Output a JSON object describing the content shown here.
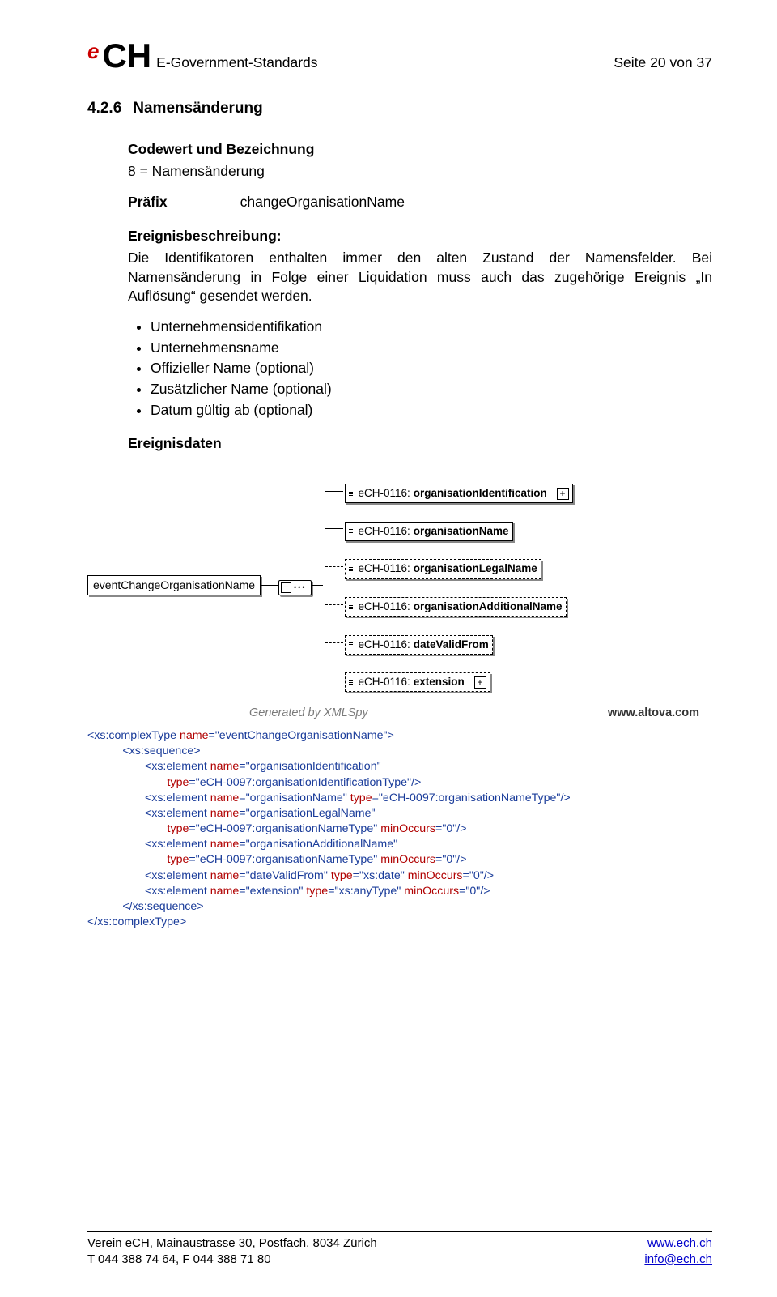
{
  "header": {
    "subtitle": "E-Government-Standards",
    "page_indicator": "Seite 20 von 37"
  },
  "logo": {
    "e": "e",
    "ch": "CH"
  },
  "section": {
    "number": "4.2.6",
    "title": "Namensänderung"
  },
  "codewert": {
    "heading": "Codewert und Bezeichnung",
    "value": "8 = Namensänderung"
  },
  "prefix": {
    "label": "Präfix",
    "value": "changeOrganisationName"
  },
  "ereignis_heading": "Ereignisbeschreibung:",
  "ereignis_text": "Die Identifikatoren enthalten immer den alten Zustand der Namensfelder. Bei Namensänderung in Folge einer Liquidation muss auch das zugehörige Ereignis „In Auflösung“ gesendet werden.",
  "bullets": [
    "Unternehmensidentifikation",
    "Unternehmensname",
    "Offizieller Name (optional)",
    "Zusätzlicher Name (optional)",
    "Datum gültig ab (optional)"
  ],
  "ereignisdaten_heading": "Ereignisdaten",
  "chart_data": {
    "type": "tree",
    "root": "eventChangeOrganisationName",
    "prefix": "eCH-0116:",
    "children": [
      {
        "name": "organisationIdentification",
        "optional": false,
        "expandable": true
      },
      {
        "name": "organisationName",
        "optional": false,
        "expandable": false
      },
      {
        "name": "organisationLegalName",
        "optional": true,
        "expandable": false
      },
      {
        "name": "organisationAdditionalName",
        "optional": true,
        "expandable": false
      },
      {
        "name": "dateValidFrom",
        "optional": true,
        "expandable": false
      },
      {
        "name": "extension",
        "optional": true,
        "expandable": true
      }
    ],
    "generated_by": "Generated by XMLSpy",
    "altova": "www.altova.com"
  },
  "xsd": {
    "l1": "<xs:complexType name=\"eventChangeOrganisationName\">",
    "l2": "<xs:sequence>",
    "l3": "<xs:element name=\"organisationIdentification\"",
    "l3b": "type=\"eCH-0097:organisationIdentificationType\"/>",
    "l4": "<xs:element name=\"organisationName\" type=\"eCH-0097:organisationNameType\"/>",
    "l5": "<xs:element name=\"organisationLegalName\"",
    "l5b": "type=\"eCH-0097:organisationNameType\" minOccurs=\"0\"/>",
    "l6": "<xs:element name=\"organisationAdditionalName\"",
    "l6b": "type=\"eCH-0097:organisationNameType\" minOccurs=\"0\"/>",
    "l7": "<xs:element name=\"dateValidFrom\" type=\"xs:date\" minOccurs=\"0\"/>",
    "l8": "<xs:element name=\"extension\" type=\"xs:anyType\" minOccurs=\"0\"/>",
    "l9": "</xs:sequence>",
    "l10": "</xs:complexType>"
  },
  "footer": {
    "line1": "Verein eCH, Mainaustrasse 30, Postfach, 8034 Zürich",
    "line2": "T 044 388 74 64, F 044 388 71 80",
    "link1": "www.ech.ch",
    "link2": "info@ech.ch"
  }
}
